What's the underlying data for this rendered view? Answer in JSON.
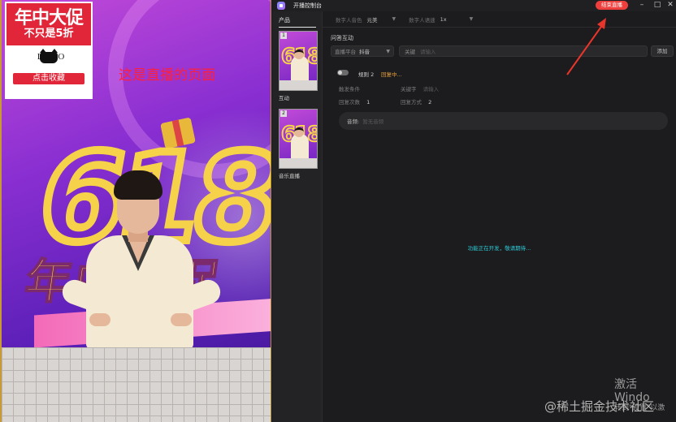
{
  "preview": {
    "promo_big": "年中大促",
    "promo_small": "不只是5折",
    "logo_text": "LOGO",
    "fav_button": "点击收藏",
    "caption": "这是直播的页面",
    "big_number": "618",
    "banner_text": "年中大促"
  },
  "app": {
    "title": "开播控制台",
    "end_live_label": "结束直播",
    "window_buttons": {
      "minimize": "–",
      "maximize": "□",
      "close": "✕"
    }
  },
  "sidebar": {
    "tab": "产品",
    "products": [
      {
        "index": "1",
        "label": "互动"
      },
      {
        "index": "2",
        "label": "音乐直播"
      }
    ]
  },
  "topbar": {
    "voice_label": "数字人音色",
    "voice_value": "元美",
    "speed_label": "数字人语速",
    "speed_value": "1x"
  },
  "main": {
    "section_title": "问答互动",
    "platform_key": "直播平台",
    "platform_value": "抖音",
    "keyword_key": "关键",
    "keyword_placeholder": "请输入",
    "add_button": "添加",
    "rule_name": "规则 2",
    "rule_status": "回复中...",
    "trigger_key": "触发条件",
    "keyword2_key": "关键字",
    "keyword2_placeholder": "请输入",
    "reply_count_key": "回复次数",
    "reply_count_value": "1",
    "reply_method_key": "回复方式",
    "reply_method_value": "2",
    "audio_key": "音频:",
    "audio_placeholder": "暂无音频",
    "dev_message": "功能正在开发，敬请期待..."
  },
  "overlays": {
    "windows_activate_l1": "激活 Windo",
    "windows_activate_l2": "转到\"设置\"以激",
    "site_watermark": "@稀土掘金技术社区"
  },
  "colors": {
    "accent_red": "#ef3f3c",
    "status_orange": "#e8a23c",
    "info_cyan": "#2ec9d6",
    "arrow_red": "#e8352b"
  }
}
